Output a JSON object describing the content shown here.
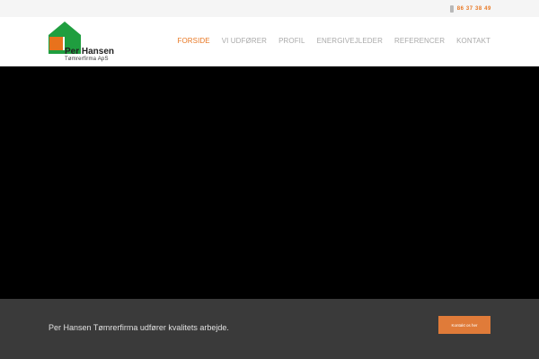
{
  "topbar": {
    "phone_icon": "phone-icon",
    "phone": "86 37 38 49"
  },
  "logo": {
    "name": "Per Hansen",
    "subtitle": "Tømrerfirma ApS",
    "colors": {
      "house": "#1f9e3f",
      "square": "#e8721c"
    }
  },
  "nav": {
    "items": [
      {
        "label": "FORSIDE",
        "active": true
      },
      {
        "label": "VI UDFØRER"
      },
      {
        "label": "PROFIL"
      },
      {
        "label": "ENERGIVEJLEDER"
      },
      {
        "label": "REFERENCER"
      },
      {
        "label": "KONTAKT"
      }
    ],
    "colors": {
      "active": "#e87722",
      "inactive": "#aaaaaa"
    }
  },
  "hero": {
    "background": "#000000"
  },
  "footer": {
    "text": "Per Hansen Tømrerfirma udfører kvalitets arbejde.",
    "cta_label": "Kontakt os her",
    "colors": {
      "background": "#3a3a3a",
      "cta": "#e07b39"
    }
  }
}
